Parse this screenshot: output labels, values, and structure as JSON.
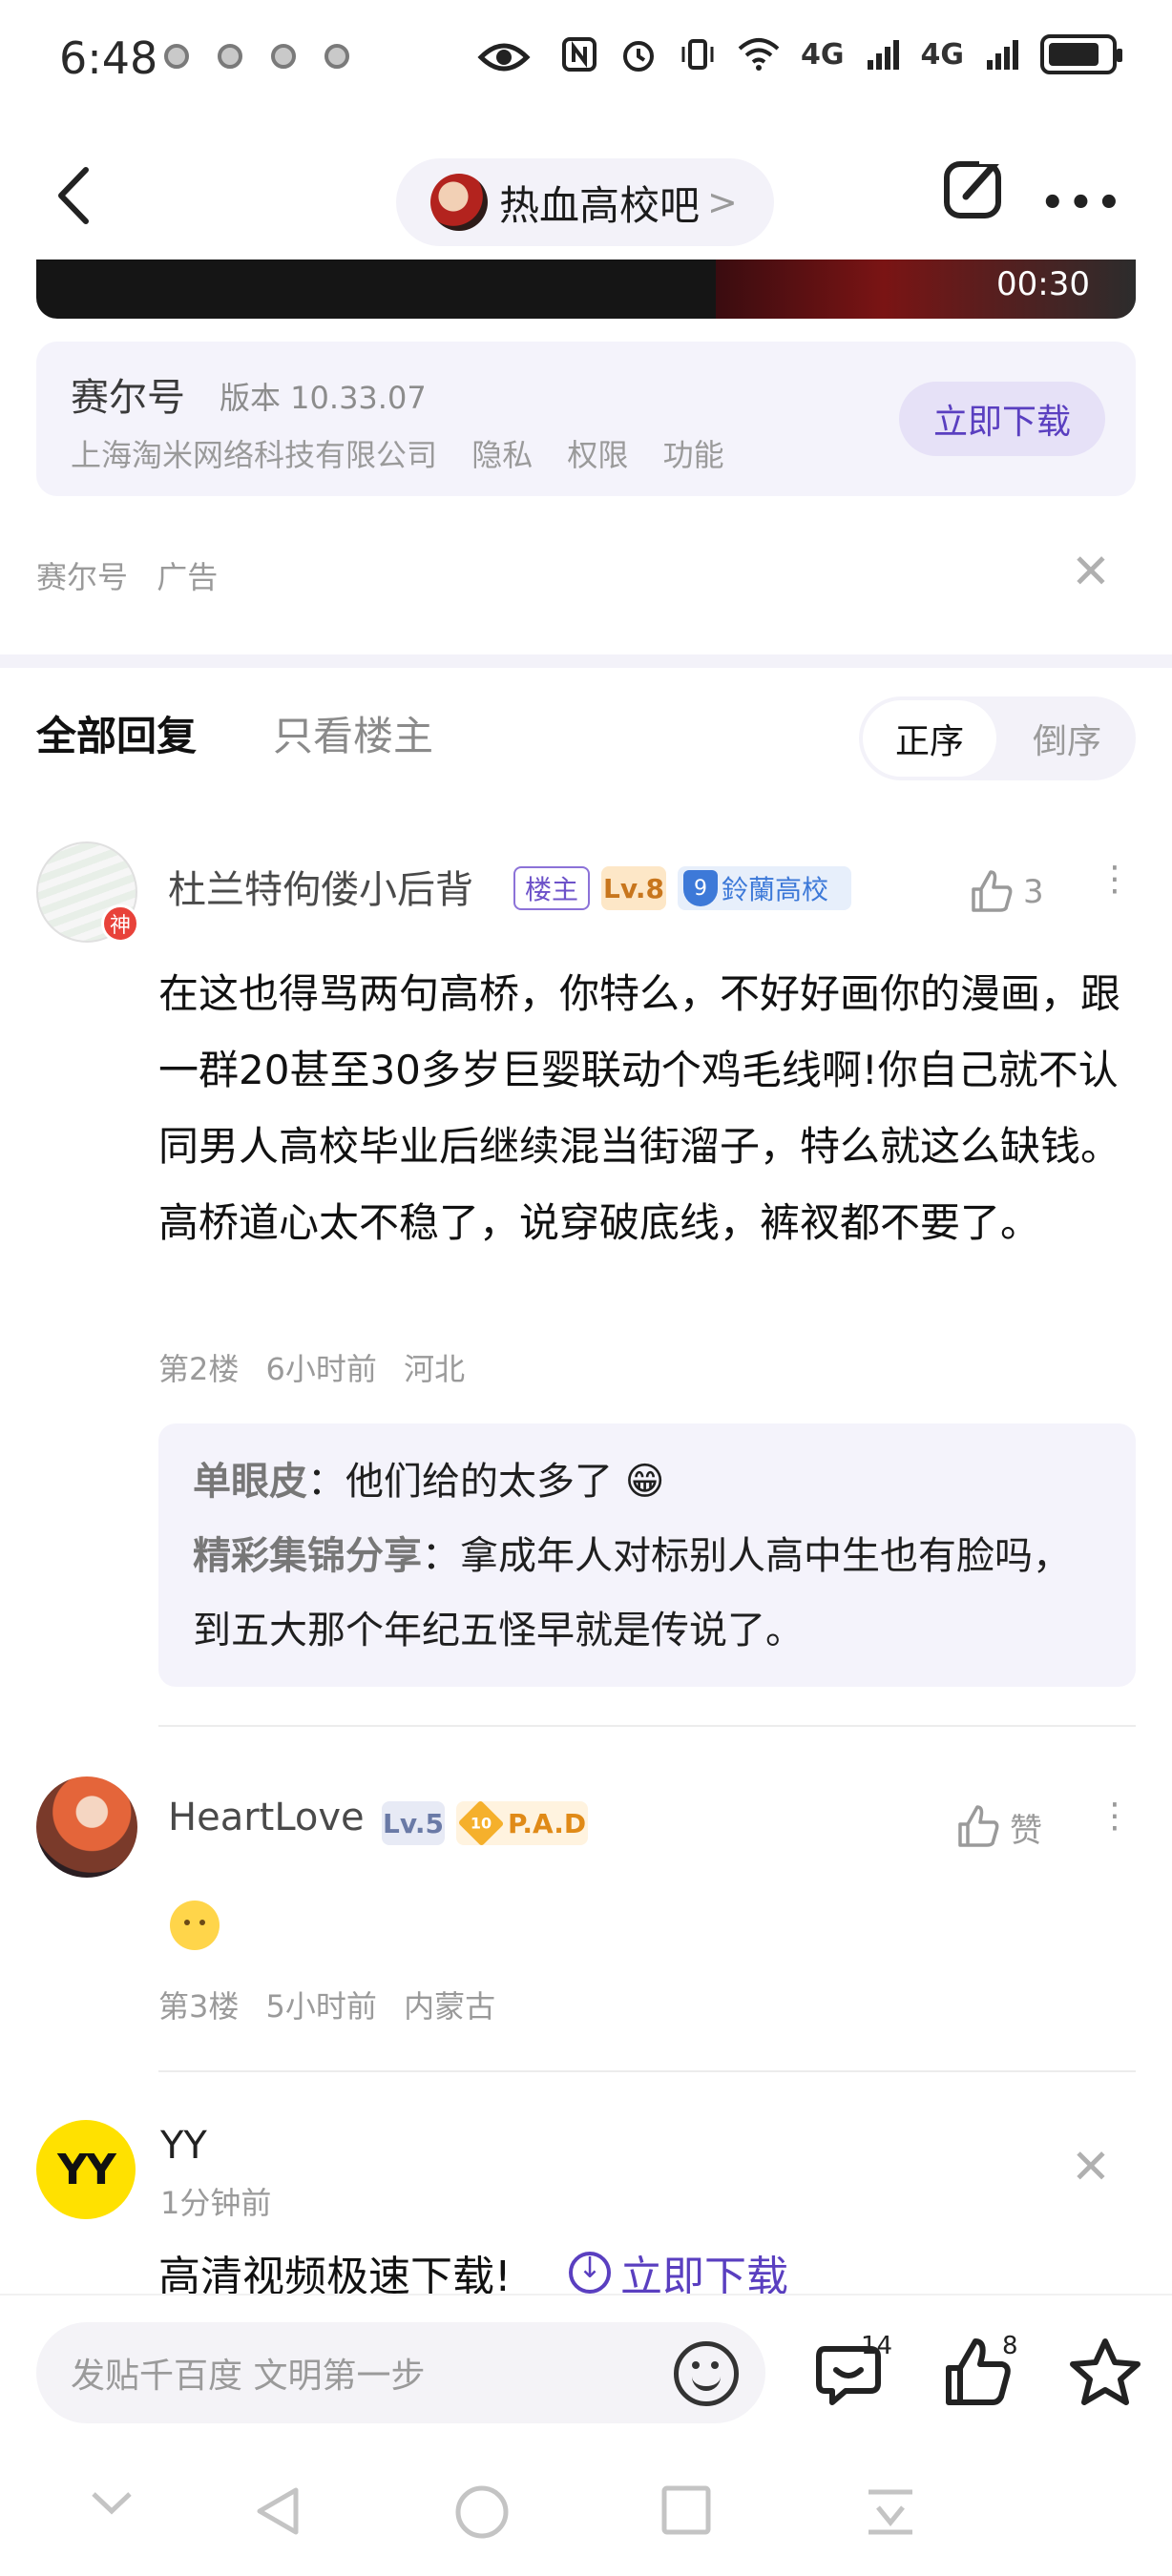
{
  "status_bar": {
    "time": "6:48",
    "net_label_1": "4G",
    "net_label_2": "4G"
  },
  "nav": {
    "forum_name": "热血高校吧",
    "chevron": ">"
  },
  "video": {
    "duration": "00:30"
  },
  "ad": {
    "app_name": "赛尔号",
    "version": "版本 10.33.07",
    "developer": "上海淘米网络科技有限公司",
    "links": [
      "隐私",
      "权限",
      "功能"
    ],
    "download_label": "立即下载",
    "source": "赛尔号",
    "ad_tag": "广告"
  },
  "tabs": {
    "all": "全部回复",
    "op_only": "只看楼主",
    "sort_asc": "正序",
    "sort_desc": "倒序"
  },
  "posts": [
    {
      "username": "杜兰特佝偻小后背",
      "god_badge": "神",
      "op_badge": "楼主",
      "level": "Lv.8",
      "club_level": "9",
      "club_name": "鈴蘭高校",
      "likes": "3",
      "body": "在这也得骂两句高桥，你特么，不好好画你的漫画，跟一群20甚至30多岁巨婴联动个鸡毛线啊!你自己就不认同男人高校毕业后继续混当街溜子，特么就这么缺钱。高桥道心太不稳了，说穿破底线，裤衩都不要了。",
      "floor": "第2楼",
      "time": "6小时前",
      "location": "河北",
      "replies": [
        {
          "who": "单眼皮",
          "text": "他们给的太多了 😁"
        },
        {
          "who": "精彩集锦分享",
          "text": "拿成年人对标别人高中生也有脸吗，到五大那个年纪五怪早就是传说了。"
        }
      ]
    },
    {
      "username": "HeartLove",
      "level": "Lv.5",
      "club_level": "10",
      "club_name": "P.A.D",
      "likes": "赞",
      "floor": "第3楼",
      "time": "5小时前",
      "location": "内蒙古"
    }
  ],
  "yy_ad": {
    "logo": "YY",
    "name": "YY",
    "time": "1分钟前",
    "text": "高清视频极速下载!",
    "download": "立即下载"
  },
  "composer": {
    "placeholder": "发贴千百度 文明第一步",
    "comment_count": "14",
    "like_count": "8"
  },
  "icons": {
    "back": "back-arrow-icon",
    "edit": "edit-icon",
    "more": "more-icon",
    "close": "close-icon",
    "like": "thumb-up-icon",
    "emoji": "emoji-icon",
    "comment": "comment-icon",
    "star": "star-icon"
  },
  "colors": {
    "accent": "#5a3fc0",
    "card_bg": "#f4f3fb",
    "op_badge": "#6d52c9",
    "level_badge": "#c8761d",
    "club_badge": "#3d79d8"
  }
}
